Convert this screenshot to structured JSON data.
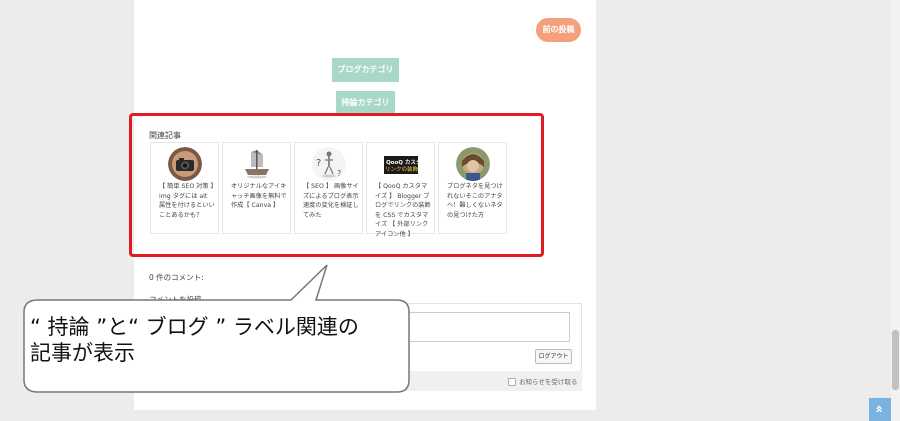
{
  "prev_post": "前の投稿",
  "tags": [
    "ブログカテゴリ",
    "持論カテゴリ"
  ],
  "related": {
    "title": "関連記事",
    "cards": [
      {
        "text": "【 簡単 SEO 対策 】img タグには alt 属性を付けるといいことあるかも？",
        "thumb": "camera"
      },
      {
        "text": "オリジナルなアイキャッチ画像を無料で作成【 Canva 】",
        "thumb": "boat"
      },
      {
        "text": "【 SEO 】 画像サイズによるブログ表示速度の変化を検証してみた",
        "thumb": "question"
      },
      {
        "text": "【 QooQ カスタマイズ 】 Blogger ブログでリンクの装飾を CSS でカスタマイズ 【 外部リンクアイコン他 】",
        "thumb": "qooq",
        "thumb_text": "QooQ カスタマイズ リンクの装飾"
      },
      {
        "text": "ブログネタを見つけれないそこのアナタへ！難しくないネタの見つけた方",
        "thumb": "person"
      }
    ]
  },
  "comments": {
    "count_label": "0 件のコメント:",
    "form_label": "コメントを投稿",
    "logout_label": "ログアウト",
    "notify_label": "お知らせを受け取る"
  },
  "callout": {
    "line1": "“ 持論 ”と“ ブログ ” ラベル関連の",
    "line2": "記事が表示"
  },
  "scroll_top_icon": "double-chevron-up-icon",
  "colors": {
    "accent_orange": "#f4a07c",
    "tag_green": "#a8d9c8",
    "highlight_red": "#e01b24",
    "scroll_blue": "#7ab3e0"
  }
}
